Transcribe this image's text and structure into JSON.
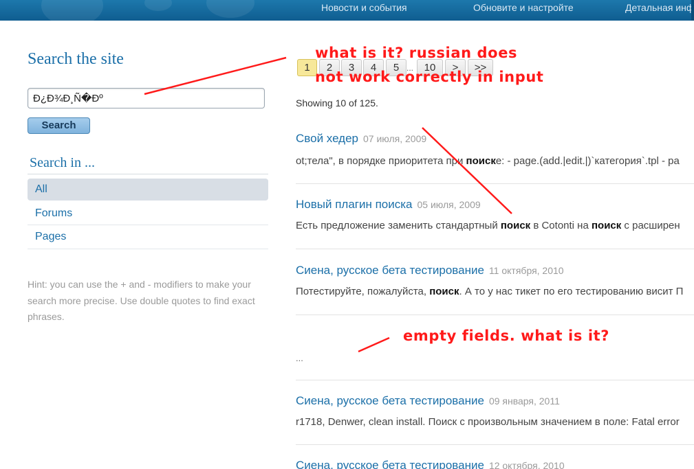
{
  "nav": {
    "links": [
      "Новости и события",
      "Обновите и настройте",
      "Детальная инф"
    ]
  },
  "sidebar": {
    "title": "Search the site",
    "search_value": "Ð¿Ð¾Ð¸Ñ�Ðº",
    "search_button": "Search",
    "search_in_title": "Search in ...",
    "filters": [
      "All",
      "Forums",
      "Pages"
    ],
    "active_filter": "All",
    "hint": "Hint: you can use the + and - modifiers to make your search more precise. Use double quotes to find exact phrases."
  },
  "pagination": {
    "pages": [
      "1",
      "2",
      "3",
      "4",
      "5",
      "10",
      ">",
      ">>"
    ],
    "current": "1",
    "gap": "..."
  },
  "showing": "Showing 10 of 125.",
  "results": [
    {
      "title": "Свой хедер",
      "date": "07 июля, 2009",
      "snippet_parts": [
        "ot;тела\", в порядке приоритета при ",
        "поиск",
        "е: - page.(add.|edit.|)`категория`.tpl - pa"
      ]
    },
    {
      "title": "Новый плагин поиска",
      "date": "05 июля, 2009",
      "snippet_parts": [
        "Есть предложение заменить стандартный ",
        "поиск",
        " в Cotonti на ",
        "поиск",
        " с расширен"
      ]
    },
    {
      "title": "Сиена, русское бета тестирование",
      "date": "11 октября, 2010",
      "snippet_parts": [
        "Потестируйте, пожалуйста, ",
        "поиск",
        ". А то у нас тикет по его тестированию висит П"
      ]
    },
    {
      "title": "",
      "date": "",
      "snippet": "..."
    },
    {
      "title": "Сиена, русское бета тестирование",
      "date": "09 января, 2011",
      "snippet_parts": [
        "r1718, Denwer, clean install. Поиск с произвольным значением в поле: Fatal error"
      ]
    },
    {
      "title": "Сиена, русское бета тестирование",
      "date": "12 октября, 2010"
    }
  ],
  "annotations": {
    "note1_line1": "what is it? russian does",
    "note1_line2": "not work correctly in input",
    "note2": "empty fields. what is it?",
    "color": "#ff1a1a"
  },
  "colors": {
    "topbar": "#1d78ac",
    "link": "#1b6fa8",
    "current_page": "#f7e89a",
    "active_filter_bg": "#d8dee5"
  }
}
